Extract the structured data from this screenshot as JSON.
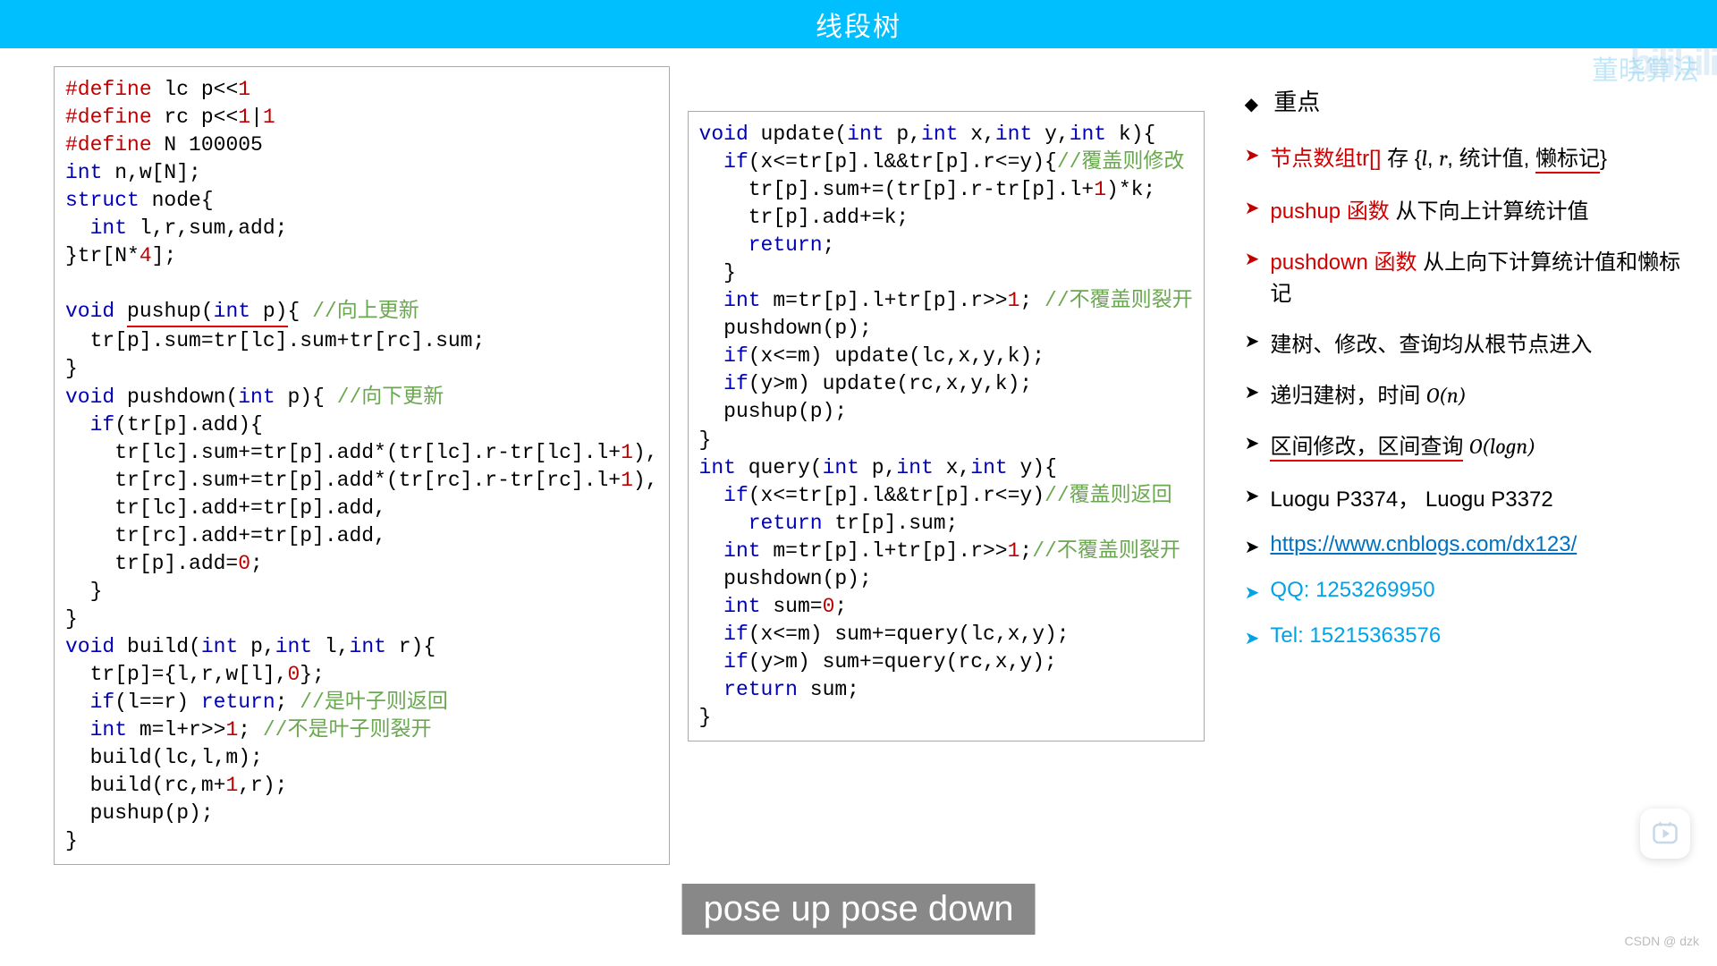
{
  "header": {
    "title": "线段树"
  },
  "watermarks": {
    "top_right_text": "董晓算法",
    "top_right_logo": "bilibili",
    "bottom_right": "CSDN @ dzk"
  },
  "code_left_html": "<span class='pre'>#define</span> lc p&lt;&lt;<span class='num'>1</span>\n<span class='pre'>#define</span> rc p&lt;&lt;<span class='num'>1</span>|<span class='num'>1</span>\n<span class='pre'>#define</span> N 100005\n<span class='kw'>int</span> n,w[N];\n<span class='kw'>struct</span> node{\n  <span class='kw'>int</span> l,r,sum,add;\n}tr[N*<span class='num'>4</span>];\n\n<span class='kw'>void</span> <span class='underline-red'>pushup(<span class='kw'>int</span> p)</span>{ <span class='cmt'>//向上更新</span>\n  tr[p].sum=tr[lc].sum+tr[rc].sum;\n}\n<span class='kw'>void</span> pushdown(<span class='kw'>int</span> p){ <span class='cmt'>//向下更新</span>\n  <span class='kw'>if</span>(tr[p].add){\n    tr[lc].sum+=tr[p].add*(tr[lc].r-tr[lc].l+<span class='num'>1</span>),\n    tr[rc].sum+=tr[p].add*(tr[rc].r-tr[rc].l+<span class='num'>1</span>),\n    tr[lc].add+=tr[p].add,\n    tr[rc].add+=tr[p].add,\n    tr[p].add=<span class='num'>0</span>;\n  }\n}\n<span class='kw'>void</span> build(<span class='kw'>int</span> p,<span class='kw'>int</span> l,<span class='kw'>int</span> r){\n  tr[p]={l,r,w[l],<span class='num'>0</span>};\n  <span class='kw'>if</span>(l==r) <span class='kw'>return</span>; <span class='cmt'>//是叶子则返回</span>\n  <span class='kw'>int</span> m=l+r&gt;&gt;<span class='num'>1</span>; <span class='cmt'>//不是叶子则裂开</span>\n  build(lc,l,m);\n  build(rc,m+<span class='num'>1</span>,r);\n  pushup(p);\n}",
  "code_mid_html": "<span class='kw'>void</span> update(<span class='kw'>int</span> p,<span class='kw'>int</span> x,<span class='kw'>int</span> y,<span class='kw'>int</span> k){\n  <span class='kw'>if</span>(x&lt;=tr[p].l&amp;&amp;tr[p].r&lt;=y){<span class='cmt'>//覆盖则修改</span>\n    tr[p].sum+=(tr[p].r-tr[p].l+<span class='num'>1</span>)*k;\n    tr[p].add+=k;\n    <span class='kw'>return</span>;\n  }\n  <span class='kw'>int</span> m=tr[p].l+tr[p].r&gt;&gt;<span class='num'>1</span>; <span class='cmt'>//不覆盖则裂开</span>\n  pushdown(p);\n  <span class='kw'>if</span>(x&lt;=m) update(lc,x,y,k);\n  <span class='kw'>if</span>(y&gt;m) update(rc,x,y,k);\n  pushup(p);\n}\n<span class='kw'>int</span> query(<span class='kw'>int</span> p,<span class='kw'>int</span> x,<span class='kw'>int</span> y){\n  <span class='kw'>if</span>(x&lt;=tr[p].l&amp;&amp;tr[p].r&lt;=y)<span class='cmt'>//覆盖则返回</span>\n    <span class='kw'>return</span> tr[p].sum;\n  <span class='kw'>int</span> m=tr[p].l+tr[p].r&gt;&gt;<span class='num'>1</span>;<span class='cmt'>//不覆盖则裂开</span>\n  pushdown(p);\n  <span class='kw'>int</span> sum=<span class='num'>0</span>;\n  <span class='kw'>if</span>(x&lt;=m) sum+=query(lc,x,y);\n  <span class='kw'>if</span>(y&gt;m) sum+=query(rc,x,y);\n  <span class='kw'>return</span> sum;\n}",
  "notes": {
    "heading": "重点",
    "items": [
      {
        "style": "red-arrow",
        "html": "<span class='red'>节点数组tr[]</span> 存 {<span class='italic'>l</span>, <span class='italic'>r</span>, 统计值, <span class='underline-red'>懒标记</span>}"
      },
      {
        "style": "red-arrow",
        "html": "<span class='red'>pushup 函数</span> 从下向上计算统计值"
      },
      {
        "style": "red-arrow",
        "html": "<span class='red'>pushdown 函数</span> 从上向下计算统计值和懒标记"
      },
      {
        "style": "black-arrow",
        "html": "建树、修改、查询均从根节点进入"
      },
      {
        "style": "black-arrow",
        "html": "递归建树，时间 <span class='italic'>O(n)</span>"
      },
      {
        "style": "black-arrow",
        "html": "<span class='underline-red'>区间修改，区间查询</span> <span class='italic'>O(logn)</span>"
      },
      {
        "style": "black-arrow",
        "html": "Luogu P3374，  Luogu P3372"
      },
      {
        "style": "black-arrow",
        "html": "<span class='link'>https://www.cnblogs.com/dx123/</span>"
      },
      {
        "style": "blue-arrow",
        "html": "<span class='blue'>QQ: 1253269950</span>"
      },
      {
        "style": "blue-arrow",
        "html": "<span class='blue'>Tel: 15215363576</span>"
      }
    ]
  },
  "caption": "pose up pose down"
}
